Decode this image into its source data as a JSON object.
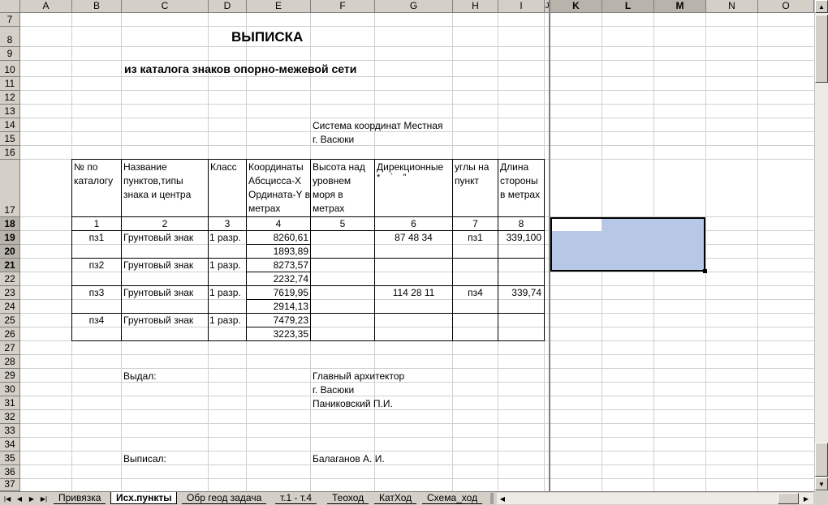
{
  "columns": [
    "A",
    "B",
    "C",
    "D",
    "E",
    "F",
    "G",
    "H",
    "I",
    "J",
    "K",
    "L",
    "M",
    "N",
    "O"
  ],
  "rows": [
    "7",
    "8",
    "9",
    "10",
    "11",
    "12",
    "13",
    "14",
    "15",
    "16",
    "17",
    "18",
    "19",
    "20",
    "21",
    "22",
    "23",
    "24",
    "25",
    "26",
    "27",
    "28",
    "29",
    "30",
    "31",
    "32",
    "33",
    "34",
    "35",
    "36",
    "37"
  ],
  "document": {
    "title": "ВЫПИСКА",
    "subtitle": "из каталога знаков опорно-межевой сети",
    "coord_system": "Система координат  Местная",
    "city": "г.   Васюки"
  },
  "table": {
    "headers": {
      "catalog_no": "№ по каталогу",
      "name": "Название пунктов,типы знака и центра",
      "class": "Класс",
      "coords": "Координаты Абсцисса-X Ордината-Y в метрах",
      "height": "Высота над уровнем моря в метрах",
      "direction": "Дирекционные",
      "direction_marks": "*    `    \"",
      "angles": "углы на пункт",
      "length": "Длина стороны в метрах"
    },
    "numbers": [
      "1",
      "2",
      "3",
      "4",
      "5",
      "6",
      "7",
      "8"
    ],
    "points": [
      {
        "id": "пз1",
        "name": "Грунтовый знак",
        "class": "1 разр.",
        "x": "8260,61",
        "y": "1893,89",
        "angle": "87 48 34",
        "to": "пз1",
        "length": "339,100"
      },
      {
        "id": "пз2",
        "name": "Грунтовый знак",
        "class": "1 разр.",
        "x": "8273,57",
        "y": "2232,74",
        "angle": "",
        "to": "",
        "length": ""
      },
      {
        "id": "пз3",
        "name": "Грунтовый знак",
        "class": "1 разр.",
        "x": "7619,95",
        "y": "2914,13",
        "angle": "114 28 11",
        "to": "пз4",
        "length": "339,74"
      },
      {
        "id": "пз4",
        "name": "Грунтовый знак",
        "class": "1 разр.",
        "x": "7479,23",
        "y": "3223,35",
        "angle": "",
        "to": "",
        "length": ""
      }
    ]
  },
  "footer": {
    "issued_label": "Выдал:",
    "issuer_title": "Главный архитектор",
    "issuer_city": "г. Васюки",
    "issuer_name": "Паниковский П.И.",
    "written_label": "Выписал:",
    "writer_name": "Балаганов А. И."
  },
  "selection": {
    "active_col": "K",
    "range": "K18:M20"
  },
  "sheet_tabs": [
    {
      "label": "Привязка",
      "active": false
    },
    {
      "label": "Исх.пункты",
      "active": true
    },
    {
      "label": "Обр геод задача",
      "active": false
    },
    {
      "label": "т.1 - т.4",
      "active": false
    },
    {
      "label": "Теоход",
      "active": false
    },
    {
      "label": "КатХод",
      "active": false
    },
    {
      "label": "Схема_ход",
      "active": false
    }
  ],
  "colors": {
    "selection": "#b6c8e6",
    "header": "#d4d0c8",
    "grid": "#d0d0d0"
  }
}
